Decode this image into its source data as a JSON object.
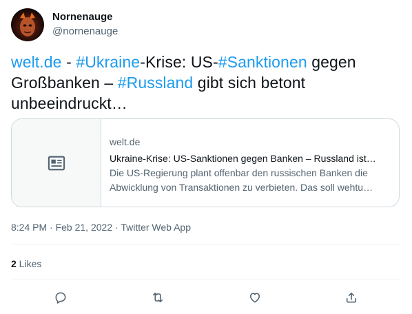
{
  "author": {
    "display_name": "Nornenauge",
    "handle": "@nornenauge",
    "avatar_icon": "avatar-image"
  },
  "tweet": {
    "segments": [
      {
        "text": "welt.de",
        "link": true
      },
      {
        "text": " - ",
        "link": false
      },
      {
        "text": "#Ukraine",
        "link": true
      },
      {
        "text": "-Krise: US-",
        "link": false
      },
      {
        "text": "#Sanktionen",
        "link": true
      },
      {
        "text": " gegen Großbanken – ",
        "link": false
      },
      {
        "text": "#Russland",
        "link": true
      },
      {
        "text": " gibt sich betont unbeeindruckt…",
        "link": false
      }
    ]
  },
  "card": {
    "thumb_icon": "news-article-icon",
    "domain": "welt.de",
    "title": "Ukraine-Krise: US-Sanktionen gegen Banken – Russland ist…",
    "description": "Die US-Regierung plant offenbar den russischen Banken die Abwicklung von Transaktionen zu verbieten. Das soll wehtu…"
  },
  "meta": {
    "time": "8:24 PM",
    "sep1": " · ",
    "date": "Feb 21, 2022",
    "sep2": " · ",
    "source": "Twitter Web App"
  },
  "stats": {
    "likes_count": "2",
    "likes_label": " Likes"
  },
  "actions": {
    "reply_icon": "reply-icon",
    "retweet_icon": "retweet-icon",
    "like_icon": "like-icon",
    "share_icon": "share-icon"
  },
  "colors": {
    "link": "#1d9bf0",
    "secondary_text": "#536471",
    "border": "#cfd9de"
  }
}
